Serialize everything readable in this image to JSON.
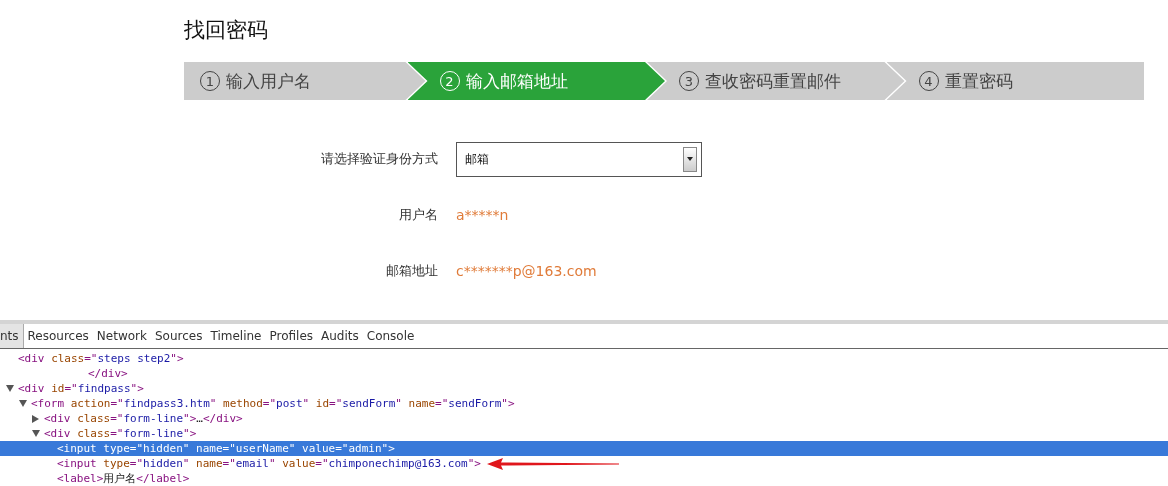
{
  "page_title": "找回密码",
  "steps": [
    {
      "number": "1",
      "label": "输入用户名",
      "selected": false
    },
    {
      "number": "2",
      "label": "输入邮箱地址",
      "selected": true
    },
    {
      "number": "3",
      "label": "查收密码重置邮件",
      "selected": false
    },
    {
      "number": "4",
      "label": "重置密码",
      "selected": false
    }
  ],
  "form": {
    "method_label": "请选择验证身份方式",
    "method_value": "邮箱",
    "rows": [
      {
        "label": "用户名",
        "value": "a*****n"
      },
      {
        "label": "邮箱地址",
        "value": "c*******p@163.com"
      }
    ]
  },
  "devtools": {
    "tabs": [
      {
        "label": "nts",
        "selected": true
      },
      {
        "label": "Resources",
        "selected": false
      },
      {
        "label": "Network",
        "selected": false
      },
      {
        "label": "Sources",
        "selected": false
      },
      {
        "label": "Timeline",
        "selected": false
      },
      {
        "label": "Profiles",
        "selected": false
      },
      {
        "label": "Audits",
        "selected": false
      },
      {
        "label": "Console",
        "selected": false
      }
    ],
    "tree": [
      {
        "selected": false,
        "tokens": [
          {
            "kind": "tag",
            "text": "<div "
          },
          {
            "kind": "attr",
            "text": "class"
          },
          {
            "kind": "tag",
            "text": "=\""
          },
          {
            "kind": "value",
            "text": "steps step2"
          },
          {
            "kind": "tag",
            "text": "\">"
          }
        ],
        "tail": [
          {
            "kind": "tag",
            "text": "</div>"
          }
        ]
      },
      {
        "selected": false,
        "expanded": true,
        "tokens": [
          {
            "kind": "tag",
            "text": "<div "
          },
          {
            "kind": "attr",
            "text": "id"
          },
          {
            "kind": "tag",
            "text": "=\""
          },
          {
            "kind": "value",
            "text": "findpass"
          },
          {
            "kind": "tag",
            "text": "\">"
          }
        ],
        "children": [
          {
            "selected": false,
            "expanded": true,
            "tokens": [
              {
                "kind": "tag",
                "text": "<form "
              },
              {
                "kind": "attr",
                "text": "action"
              },
              {
                "kind": "tag",
                "text": "=\""
              },
              {
                "kind": "value",
                "text": "findpass3.htm"
              },
              {
                "kind": "tag",
                "text": "\" "
              },
              {
                "kind": "attr",
                "text": "method"
              },
              {
                "kind": "tag",
                "text": "=\""
              },
              {
                "kind": "value",
                "text": "post"
              },
              {
                "kind": "tag",
                "text": "\" "
              },
              {
                "kind": "attr",
                "text": "id"
              },
              {
                "kind": "tag",
                "text": "=\""
              },
              {
                "kind": "value",
                "text": "sendForm"
              },
              {
                "kind": "tag",
                "text": "\" "
              },
              {
                "kind": "attr",
                "text": "name"
              },
              {
                "kind": "tag",
                "text": "=\""
              },
              {
                "kind": "value",
                "text": "sendForm"
              },
              {
                "kind": "tag",
                "text": "\">"
              }
            ],
            "children": [
              {
                "selected": false,
                "expanded": false,
                "tokens": [
                  {
                    "kind": "tag",
                    "text": "<div "
                  },
                  {
                    "kind": "attr",
                    "text": "class"
                  },
                  {
                    "kind": "tag",
                    "text": "=\""
                  },
                  {
                    "kind": "value",
                    "text": "form-line"
                  },
                  {
                    "kind": "tag",
                    "text": "\">"
                  },
                  {
                    "kind": "text",
                    "text": "…"
                  },
                  {
                    "kind": "tag",
                    "text": "</div>"
                  }
                ]
              },
              {
                "selected": false,
                "expanded": true,
                "tokens": [
                  {
                    "kind": "tag",
                    "text": "<div "
                  },
                  {
                    "kind": "attr",
                    "text": "class"
                  },
                  {
                    "kind": "tag",
                    "text": "=\""
                  },
                  {
                    "kind": "value",
                    "text": "form-line"
                  },
                  {
                    "kind": "tag",
                    "text": "\">"
                  }
                ],
                "children": [
                  {
                    "selected": true,
                    "tokens": [
                      {
                        "kind": "tag",
                        "text": "<input "
                      },
                      {
                        "kind": "attr",
                        "text": "type"
                      },
                      {
                        "kind": "tag",
                        "text": "=\""
                      },
                      {
                        "kind": "value",
                        "text": "hidden"
                      },
                      {
                        "kind": "tag",
                        "text": "\" "
                      },
                      {
                        "kind": "attr",
                        "text": "name"
                      },
                      {
                        "kind": "tag",
                        "text": "=\""
                      },
                      {
                        "kind": "value",
                        "text": "userName"
                      },
                      {
                        "kind": "tag",
                        "text": "\" "
                      },
                      {
                        "kind": "attr",
                        "text": "value"
                      },
                      {
                        "kind": "tag",
                        "text": "=\""
                      },
                      {
                        "kind": "value",
                        "text": "admin"
                      },
                      {
                        "kind": "tag",
                        "text": "\">"
                      }
                    ]
                  },
                  {
                    "selected": false,
                    "marked": true,
                    "tokens": [
                      {
                        "kind": "tag",
                        "text": "<input "
                      },
                      {
                        "kind": "attr",
                        "text": "type"
                      },
                      {
                        "kind": "tag",
                        "text": "=\""
                      },
                      {
                        "kind": "value",
                        "text": "hidden"
                      },
                      {
                        "kind": "tag",
                        "text": "\" "
                      },
                      {
                        "kind": "attr",
                        "text": "name"
                      },
                      {
                        "kind": "tag",
                        "text": "=\""
                      },
                      {
                        "kind": "value",
                        "text": "email"
                      },
                      {
                        "kind": "tag",
                        "text": "\" "
                      },
                      {
                        "kind": "attr",
                        "text": "value"
                      },
                      {
                        "kind": "tag",
                        "text": "=\""
                      },
                      {
                        "kind": "value",
                        "text": "chimponechimp@163.com"
                      },
                      {
                        "kind": "tag",
                        "text": "\">"
                      }
                    ]
                  },
                  {
                    "selected": false,
                    "tokens": [
                      {
                        "kind": "tag",
                        "text": "<label>"
                      },
                      {
                        "kind": "text",
                        "text": "用户名"
                      },
                      {
                        "kind": "tag",
                        "text": "</label>"
                      }
                    ]
                  }
                ]
              }
            ]
          }
        ]
      }
    ]
  }
}
